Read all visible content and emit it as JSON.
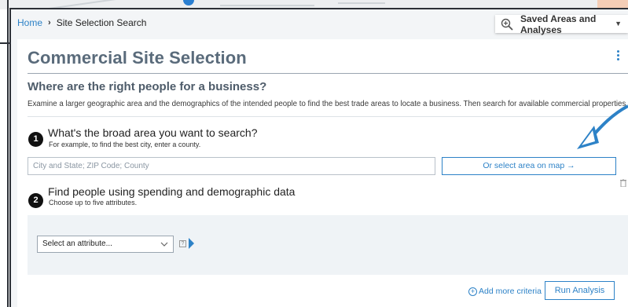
{
  "breadcrumb": {
    "home": "Home",
    "separator": "›",
    "current": "Site Selection Search"
  },
  "saved": {
    "label": "Saved Areas and Analyses",
    "caret": "▼"
  },
  "page": {
    "title": "Commercial Site Selection",
    "subtitle": "Where are the right people for a business?",
    "intro": "Examine a larger geographic area and the demographics of the intended people to find the best trade areas to locate a business. Then search for available commercial properties.",
    "help": "?"
  },
  "step1": {
    "number": "1",
    "title": "What's the broad area you want to search?",
    "desc": "For example, to find the best city, enter a county.",
    "input_placeholder": "City and State; ZIP Code; County",
    "input_value": "",
    "map_button": "Or select area on map →"
  },
  "step2": {
    "number": "2",
    "title": "Find people using spending and demographic data",
    "desc": "Choose up to five attributes.",
    "select_value": "Select an attribute...",
    "help": "?"
  },
  "actions": {
    "add_criteria": "Add more criteria",
    "add_plus": "+",
    "run": "Run Analysis"
  },
  "colors": {
    "accent": "#2d82c7",
    "title": "#5a6b7b",
    "frame": "#2b2f36"
  }
}
